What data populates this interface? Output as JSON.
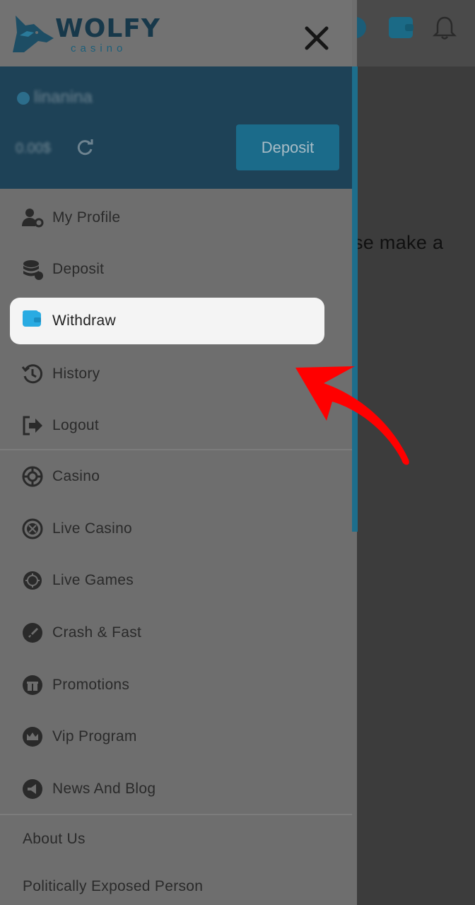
{
  "background": {
    "partial_text": "se make a"
  },
  "drawer": {
    "logo": {
      "word": "WOLFY",
      "sub": "casino"
    },
    "user": {
      "username": "linanina",
      "balance": "0.00$",
      "deposit_label": "Deposit"
    },
    "account_menu": [
      {
        "label": "My Profile",
        "icon": "user-gear-icon"
      },
      {
        "label": "Deposit",
        "icon": "coins-icon"
      },
      {
        "label": "Withdraw",
        "icon": "wallet-icon"
      },
      {
        "label": "History",
        "icon": "history-icon"
      },
      {
        "label": "Logout",
        "icon": "logout-icon"
      }
    ],
    "nav_menu": [
      {
        "label": "Casino",
        "icon": "casino-chip-icon"
      },
      {
        "label": "Live Casino",
        "icon": "roulette-icon"
      },
      {
        "label": "Live Games",
        "icon": "live-games-icon"
      },
      {
        "label": "Crash & Fast",
        "icon": "rocket-icon"
      },
      {
        "label": "Promotions",
        "icon": "gift-icon"
      },
      {
        "label": "Vip Program",
        "icon": "crown-icon"
      },
      {
        "label": "News And Blog",
        "icon": "megaphone-icon"
      }
    ],
    "info_links": [
      "About Us",
      "Politically Exposed Person"
    ]
  },
  "colors": {
    "accent": "#1b6b8a",
    "highlight_bg": "#f4f4f4",
    "wallet_icon": "#29abe2",
    "arrow": "#ff0000"
  }
}
